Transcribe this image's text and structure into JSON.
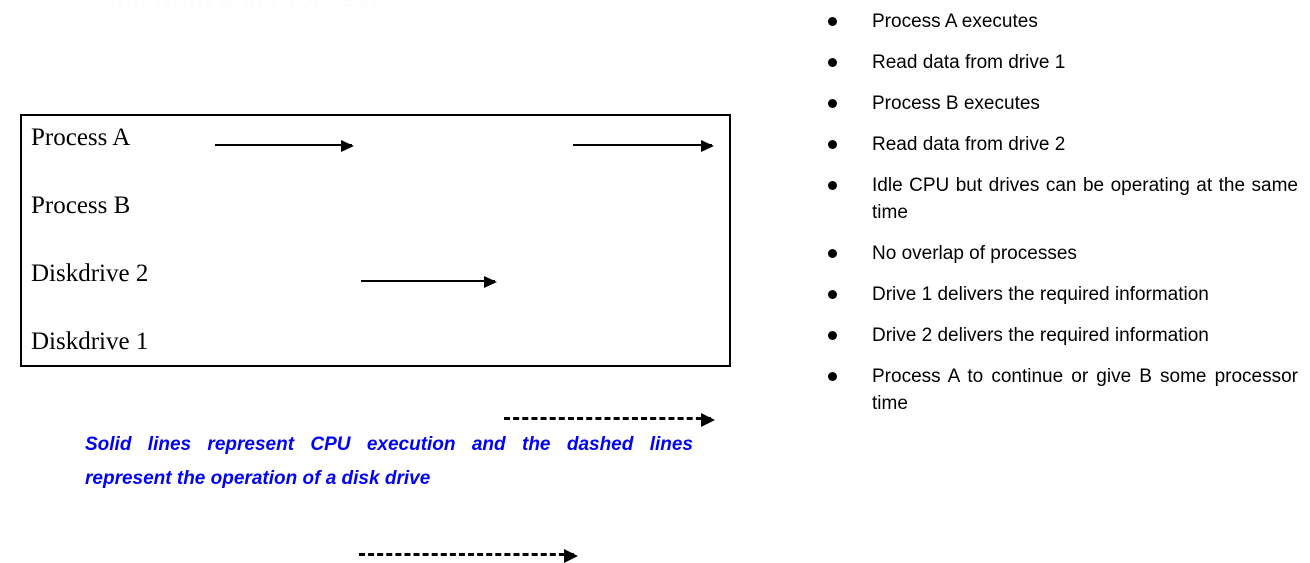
{
  "slide": {
    "title": "Interrupt and Process?"
  },
  "diagram": {
    "name": "process-timing-diagram",
    "lanes": [
      {
        "label": "Process A",
        "kind": "cpu",
        "segments": 2
      },
      {
        "label": "Process B",
        "kind": "cpu",
        "segments": 1
      },
      {
        "label": "Diskdrive 2",
        "kind": "disk",
        "segments": 1
      },
      {
        "label": "Diskdrive 1",
        "kind": "disk",
        "segments": 1
      }
    ],
    "caption": "Solid lines represent CPU execution and the dashed lines represent the operation of a disk drive",
    "caption_color": "#0000FF",
    "border_color": "#000000",
    "line_color": "#000000"
  },
  "bullets": [
    {
      "text": "Process A executes"
    },
    {
      "text": "Read data from drive 1"
    },
    {
      "text": "Process B executes"
    },
    {
      "text": "Read data from drive 2"
    },
    {
      "text": "Idle CPU but drives can be operating at the same time"
    },
    {
      "text": "No overlap of processes"
    },
    {
      "text": "Drive 1 delivers the required information"
    },
    {
      "text": "Drive 2 delivers the required information"
    },
    {
      "text": "Process A to continue or give B some processor time"
    }
  ]
}
